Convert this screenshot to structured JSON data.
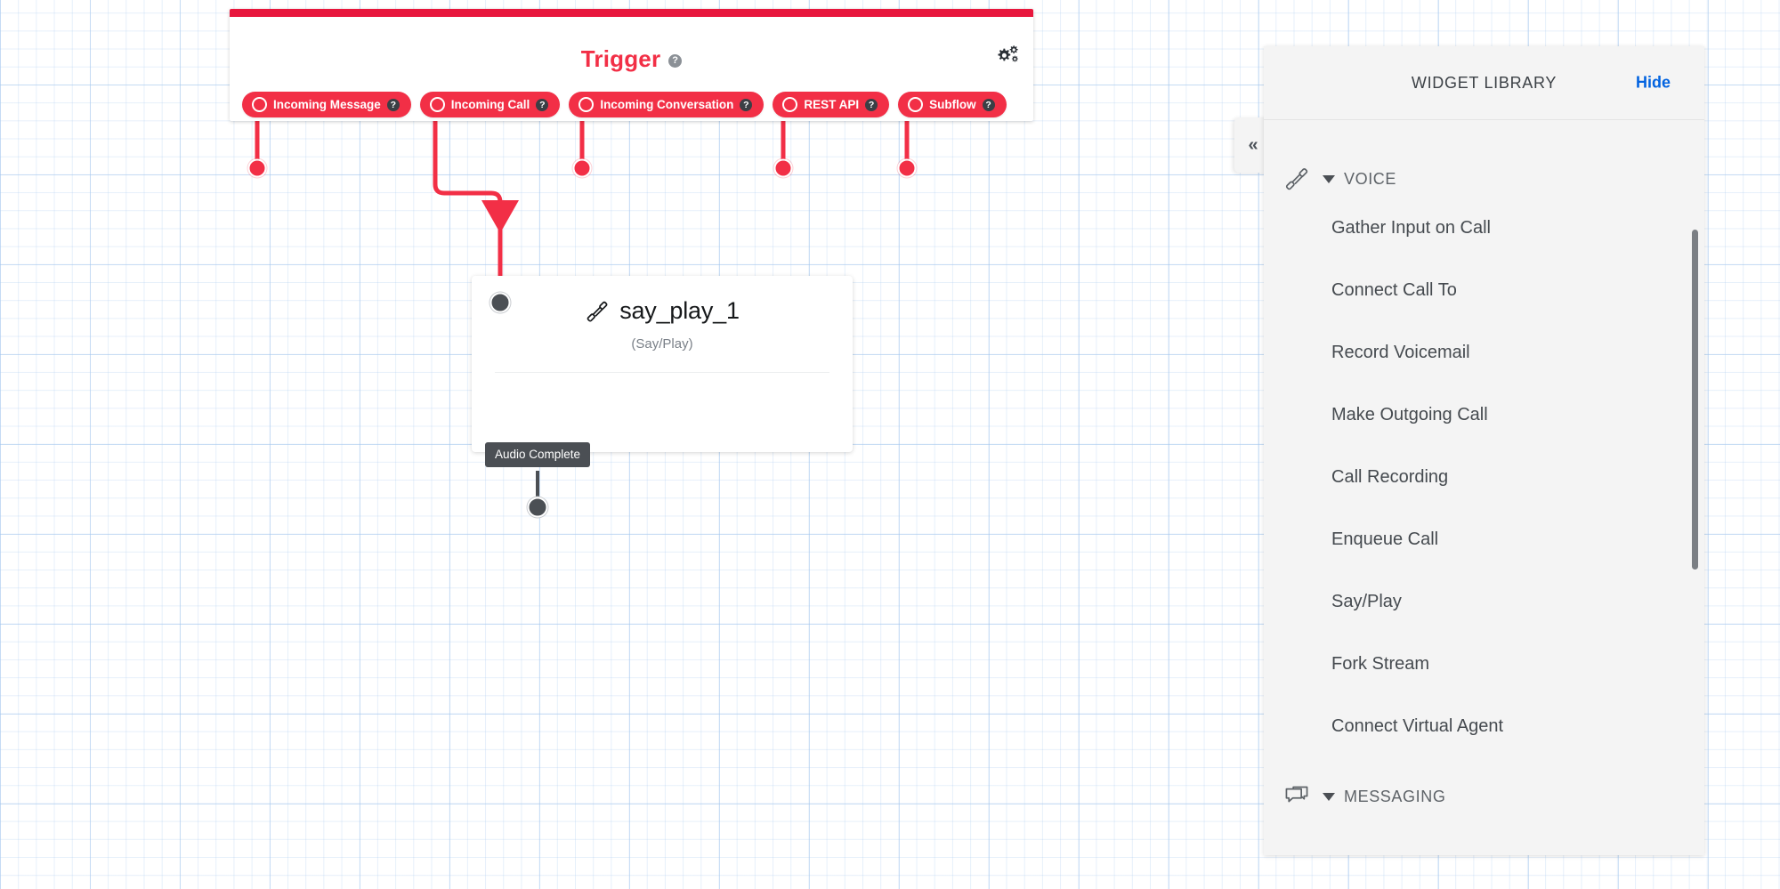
{
  "trigger": {
    "title": "Trigger",
    "help_glyph": "?",
    "gear_icon": "gears-icon",
    "pills": [
      {
        "label": "Incoming Message",
        "help": "?"
      },
      {
        "label": "Incoming Call",
        "help": "?"
      },
      {
        "label": "Incoming Conversation",
        "help": "?"
      },
      {
        "label": "REST API",
        "help": "?"
      },
      {
        "label": "Subflow",
        "help": "?"
      }
    ],
    "accent_color": "#f22f46",
    "topbar_color": "#e8173d"
  },
  "node": {
    "name": "say_play_1",
    "type_label": "(Say/Play)",
    "icon": "phone-handset-icon",
    "output_label": "Audio Complete"
  },
  "library": {
    "title": "WIDGET LIBRARY",
    "hide_label": "Hide",
    "hide_color": "#0263e0",
    "collapse_glyph": "«",
    "groups": [
      {
        "name": "VOICE",
        "icon": "phone-handset-icon",
        "expanded": true,
        "items": [
          "Gather Input on Call",
          "Connect Call To",
          "Record Voicemail",
          "Make Outgoing Call",
          "Call Recording",
          "Enqueue Call",
          "Say/Play",
          "Fork Stream",
          "Connect Virtual Agent"
        ]
      },
      {
        "name": "MESSAGING",
        "icon": "chat-bubble-icon",
        "expanded": true,
        "items": []
      }
    ]
  }
}
